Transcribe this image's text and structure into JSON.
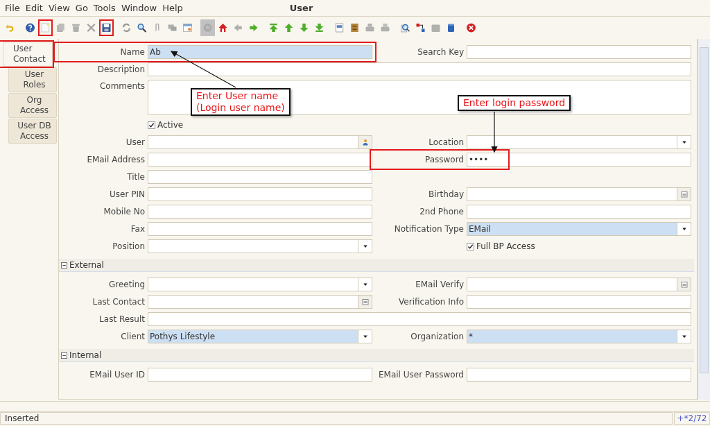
{
  "window": {
    "title": "User"
  },
  "menu": [
    "File",
    "Edit",
    "View",
    "Go",
    "Tools",
    "Window",
    "Help"
  ],
  "toolbar": [
    {
      "kind": "undo",
      "disabled": false,
      "marked": false
    },
    {
      "kind": "help",
      "disabled": false,
      "marked": false
    },
    {
      "kind": "new",
      "disabled": false,
      "marked": true
    },
    {
      "kind": "copy",
      "disabled": true,
      "marked": false
    },
    {
      "kind": "delete",
      "disabled": true,
      "marked": false
    },
    {
      "kind": "delete-selection",
      "disabled": true,
      "marked": false
    },
    {
      "kind": "save",
      "disabled": false,
      "marked": true
    },
    {
      "kind": "refresh",
      "disabled": false,
      "marked": false
    },
    {
      "kind": "find",
      "disabled": false,
      "marked": false
    },
    {
      "kind": "attach",
      "disabled": true,
      "marked": false
    },
    {
      "kind": "chat",
      "disabled": true,
      "marked": false
    },
    {
      "kind": "grid",
      "disabled": false,
      "marked": false
    },
    {
      "kind": "history",
      "disabled": true,
      "marked": false
    },
    {
      "kind": "home",
      "disabled": false,
      "marked": false
    },
    {
      "kind": "previous",
      "disabled": true,
      "marked": false
    },
    {
      "kind": "next",
      "disabled": false,
      "marked": false
    },
    {
      "kind": "first",
      "disabled": false,
      "marked": false
    },
    {
      "kind": "up",
      "disabled": false,
      "marked": false
    },
    {
      "kind": "down",
      "disabled": false,
      "marked": false
    },
    {
      "kind": "last",
      "disabled": false,
      "marked": false
    },
    {
      "kind": "report",
      "disabled": false,
      "marked": false
    },
    {
      "kind": "archive",
      "disabled": false,
      "marked": false
    },
    {
      "kind": "print",
      "disabled": true,
      "marked": false
    },
    {
      "kind": "print-preview",
      "disabled": true,
      "marked": false
    },
    {
      "kind": "zoom",
      "disabled": false,
      "marked": false
    },
    {
      "kind": "request",
      "disabled": false,
      "marked": false
    },
    {
      "kind": "product",
      "disabled": true,
      "marked": false
    },
    {
      "kind": "workflow",
      "disabled": false,
      "marked": false
    },
    {
      "kind": "exit",
      "disabled": false,
      "marked": false
    }
  ],
  "tabs": [
    {
      "label": "User Contact",
      "selected": true,
      "marked": true
    },
    {
      "label": "User Roles",
      "selected": false,
      "marked": false
    },
    {
      "label": "Org Access",
      "selected": false,
      "marked": false
    },
    {
      "label": "User DB Access",
      "selected": false,
      "marked": false
    }
  ],
  "sections": [
    {
      "rows": [
        [
          {
            "kind": "text",
            "label": "Name",
            "value": "Ab",
            "mandatory": true,
            "marked": true
          },
          {
            "kind": "text",
            "label": "Search Key"
          }
        ],
        [
          {
            "kind": "wide",
            "label": "Description"
          }
        ],
        [
          {
            "kind": "textarea",
            "label": "Comments"
          }
        ],
        [
          {
            "kind": "checkbox",
            "label": "Active",
            "checked": true
          }
        ],
        [
          {
            "kind": "lookup",
            "label": "User"
          },
          {
            "kind": "combo",
            "label": "Location"
          }
        ],
        [
          {
            "kind": "text",
            "label": "EMail Address"
          },
          {
            "kind": "password",
            "label": "Password",
            "value": "••••",
            "marked": true
          }
        ],
        [
          {
            "kind": "text",
            "label": "Title"
          }
        ],
        [
          {
            "kind": "text",
            "label": "User PIN"
          },
          {
            "kind": "date",
            "label": "Birthday"
          }
        ],
        [
          {
            "kind": "text",
            "label": "Mobile No"
          },
          {
            "kind": "text",
            "label": "2nd Phone"
          }
        ],
        [
          {
            "kind": "text",
            "label": "Fax"
          },
          {
            "kind": "combo",
            "label": "Notification Type",
            "value": "EMail",
            "mandatory": true
          }
        ],
        [
          {
            "kind": "combo",
            "label": "Position"
          },
          {
            "kind": "checkbox",
            "label": "Full BP Access",
            "checked": true
          }
        ]
      ]
    },
    {
      "title": "External",
      "expanded": true,
      "rows": [
        [
          {
            "kind": "combo",
            "label": "Greeting"
          },
          {
            "kind": "date",
            "label": "EMail Verify"
          }
        ],
        [
          {
            "kind": "date",
            "label": "Last Contact"
          },
          {
            "kind": "text",
            "label": "Verification Info"
          }
        ],
        [
          {
            "kind": "wide",
            "label": "Last Result"
          }
        ],
        [
          {
            "kind": "combo",
            "label": "Client",
            "value": "Pothys Lifestyle",
            "mandatory": true
          },
          {
            "kind": "combo",
            "label": "Organization",
            "value": "*",
            "mandatory": true
          }
        ]
      ]
    },
    {
      "title": "Internal",
      "expanded": true,
      "rows": [
        [
          {
            "kind": "text",
            "label": "EMail User ID"
          },
          {
            "kind": "text",
            "label": "EMail User Password"
          }
        ]
      ]
    }
  ],
  "callouts": [
    "Enter User name\n(Login user name)",
    "Enter login password"
  ],
  "status_bar": {
    "message": "Inserted",
    "record": "+*2/72"
  }
}
